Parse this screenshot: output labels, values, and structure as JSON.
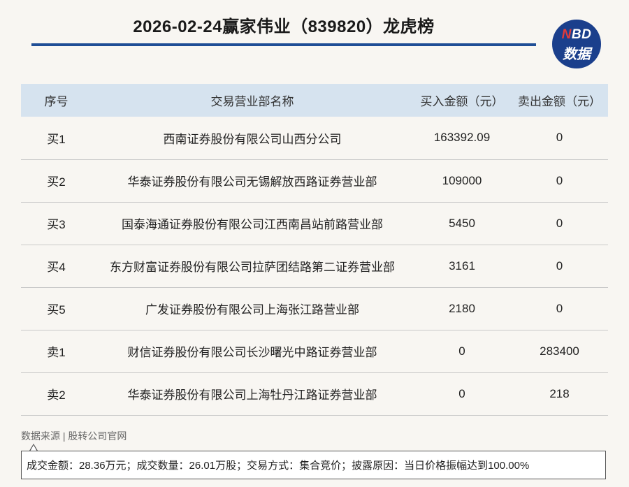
{
  "header": {
    "title": "2026-02-24赢家伟业（839820）龙虎榜"
  },
  "logo": {
    "line1_n": "N",
    "line1_rest": "BD",
    "line2": "数据",
    "color": "#1b3f8c",
    "accent": "#e23b3b"
  },
  "table": {
    "columns": [
      "序号",
      "交易营业部名称",
      "买入金额（元）",
      "卖出金额（元）"
    ],
    "rows": [
      {
        "seq": "买1",
        "name": "西南证券股份有限公司山西分公司",
        "buy": "163392.09",
        "sell": "0"
      },
      {
        "seq": "买2",
        "name": "华泰证券股份有限公司无锡解放西路证券营业部",
        "buy": "109000",
        "sell": "0"
      },
      {
        "seq": "买3",
        "name": "国泰海通证券股份有限公司江西南昌站前路营业部",
        "buy": "5450",
        "sell": "0"
      },
      {
        "seq": "买4",
        "name": "东方财富证券股份有限公司拉萨团结路第二证券营业部",
        "buy": "3161",
        "sell": "0"
      },
      {
        "seq": "买5",
        "name": "广发证券股份有限公司上海张江路营业部",
        "buy": "2180",
        "sell": "0"
      },
      {
        "seq": "卖1",
        "name": "财信证券股份有限公司长沙曙光中路证券营业部",
        "buy": "0",
        "sell": "283400"
      },
      {
        "seq": "卖2",
        "name": "华泰证券股份有限公司上海牡丹江路证券营业部",
        "buy": "0",
        "sell": "218"
      }
    ]
  },
  "footer": {
    "source": "数据来源 | 股转公司官网",
    "note": "成交金额：28.36万元；成交数量：26.01万股；交易方式：集合竞价；披露原因：当日价格振幅达到100.00%"
  }
}
